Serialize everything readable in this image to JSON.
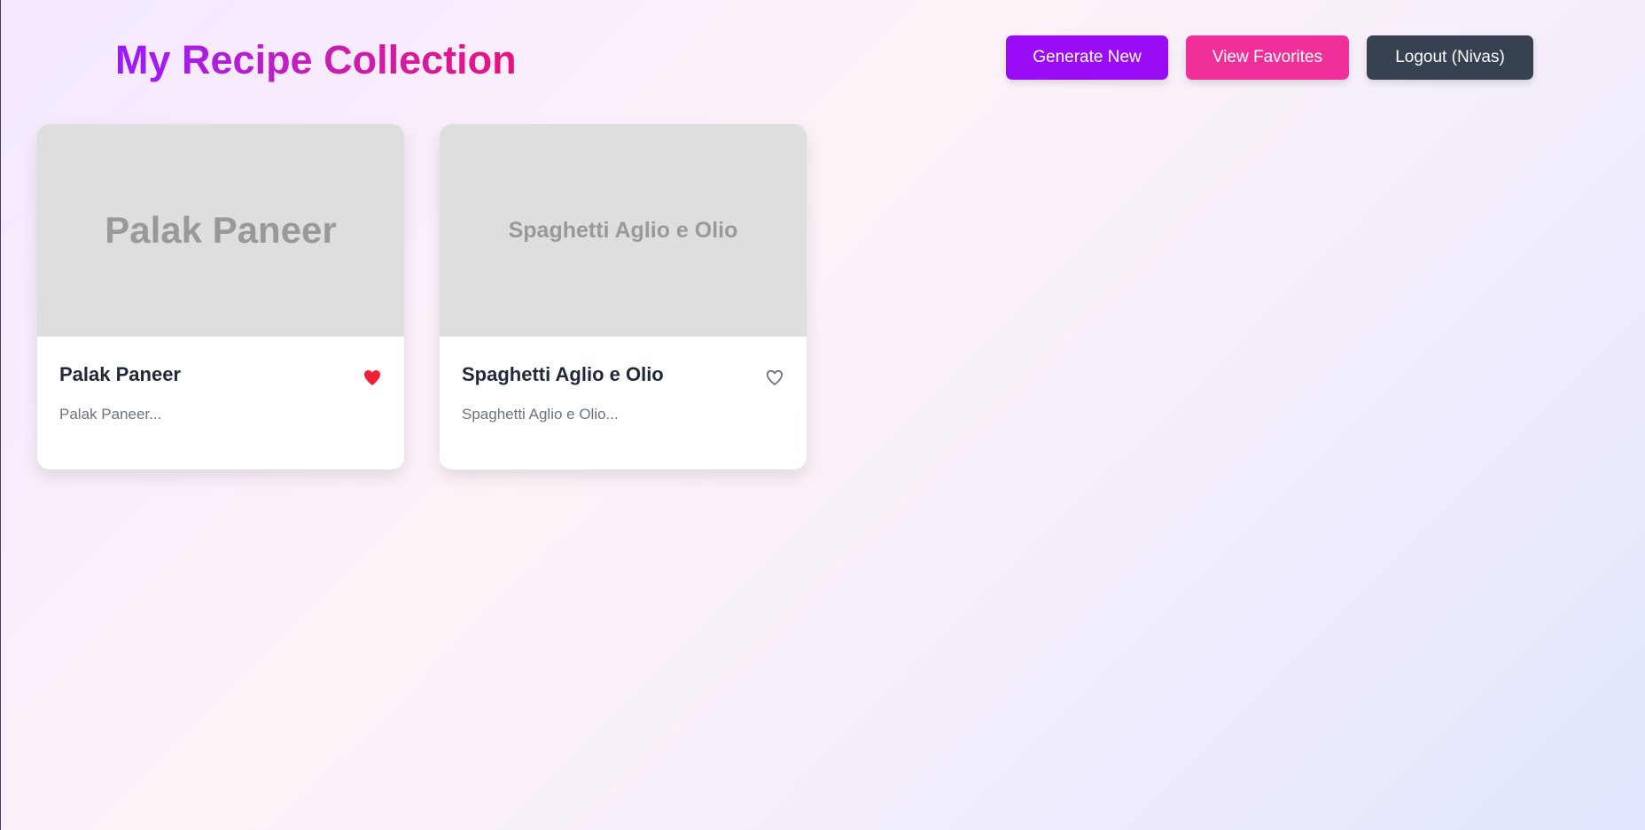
{
  "header": {
    "title": "My Recipe Collection",
    "buttons": {
      "generate_label": "Generate New",
      "favorites_label": "View Favorites",
      "logout_label": "Logout (Nivas)"
    }
  },
  "recipes": [
    {
      "image_text": "Palak Paneer",
      "title": "Palak Paneer",
      "description": "Palak Paneer...",
      "favorite": true,
      "favorite_icon": "heart-filled-icon"
    },
    {
      "image_text": "Spaghetti Aglio e Olio",
      "title": "Spaghetti Aglio e Olio",
      "description": "Spaghetti Aglio e Olio...",
      "favorite": false,
      "favorite_icon": "heart-outline-icon"
    }
  ],
  "colors": {
    "accent_purple": "#9a0cf5",
    "accent_pink": "#f0309a",
    "dark": "#374151",
    "favorite_red": "#ef1f35"
  }
}
